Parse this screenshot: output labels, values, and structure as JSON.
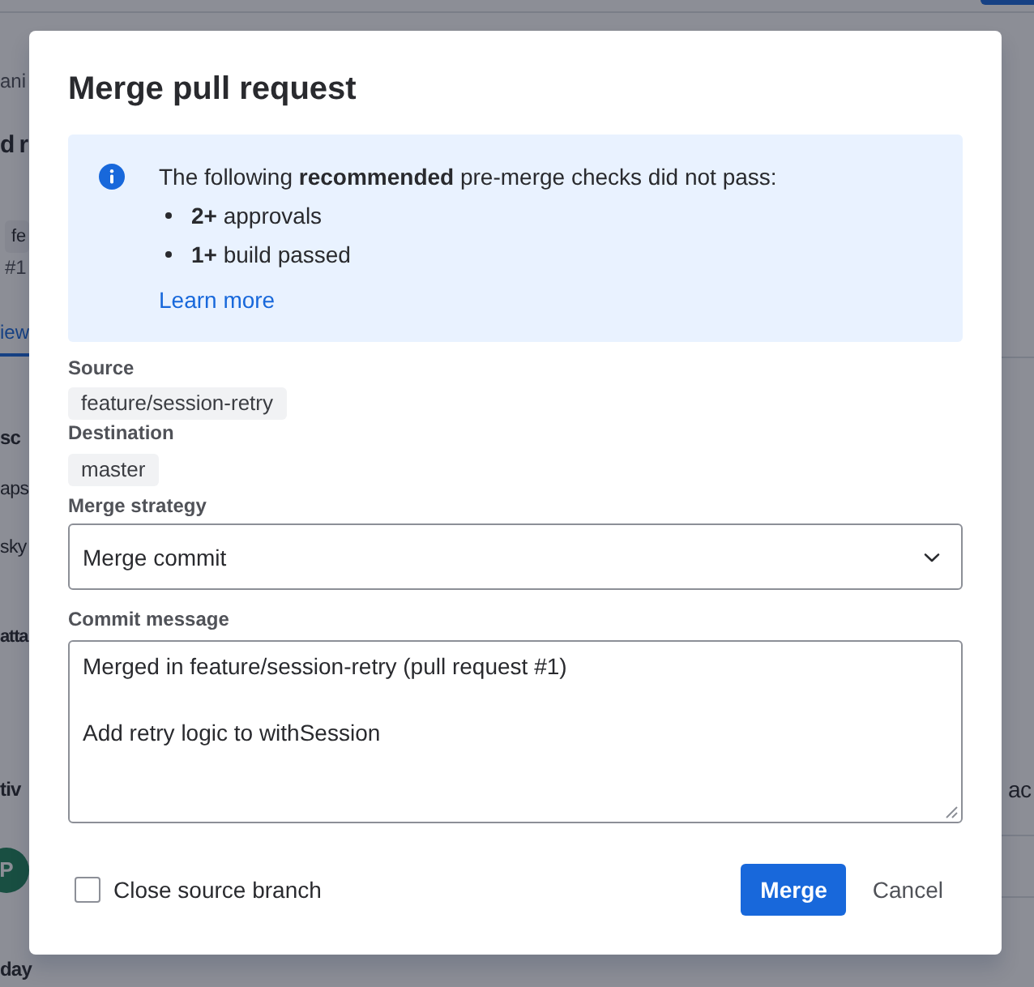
{
  "background_page": {
    "left": [
      {
        "kind": "breadcrumb",
        "text": "ani"
      },
      {
        "kind": "title",
        "text": "d r"
      },
      {
        "kind": "badge",
        "text": "fe"
      },
      {
        "kind": "meta",
        "text": "#1"
      },
      {
        "kind": "tab",
        "text": "iew",
        "selected": true
      },
      {
        "kind": "heading",
        "text": "sc"
      },
      {
        "kind": "text",
        "text": "aps"
      },
      {
        "kind": "text",
        "text": "sky"
      },
      {
        "kind": "heading",
        "text": "atta"
      },
      {
        "kind": "heading",
        "text": "tiv"
      },
      {
        "kind": "avatar",
        "text": "P"
      },
      {
        "kind": "heading",
        "text": "day"
      }
    ],
    "right": [
      {
        "kind": "text",
        "text": "ac"
      }
    ]
  },
  "dialog": {
    "title": "Merge pull request",
    "notice": {
      "message": "The following **recommended** pre-merge checks did not pass:",
      "items": [
        "**2+** approvals",
        "**1+** build passed"
      ],
      "link": "Learn more"
    },
    "source": {
      "label": "Source",
      "branch": "feature/session-retry"
    },
    "destination": {
      "label": "Destination",
      "branch": "master"
    },
    "merge_strategy": {
      "label": "Merge strategy",
      "value": "Merge commit"
    },
    "commit_message": {
      "label": "Commit message",
      "value": "Merged in feature/session-retry (pull request #1)\n\nAdd retry logic to withSession"
    },
    "close_source_branch": {
      "label": "Close source branch",
      "checked": false
    },
    "buttons": [
      {
        "label": "Merge",
        "kind": "primary"
      },
      {
        "label": "Cancel",
        "kind": "subtle"
      }
    ]
  }
}
